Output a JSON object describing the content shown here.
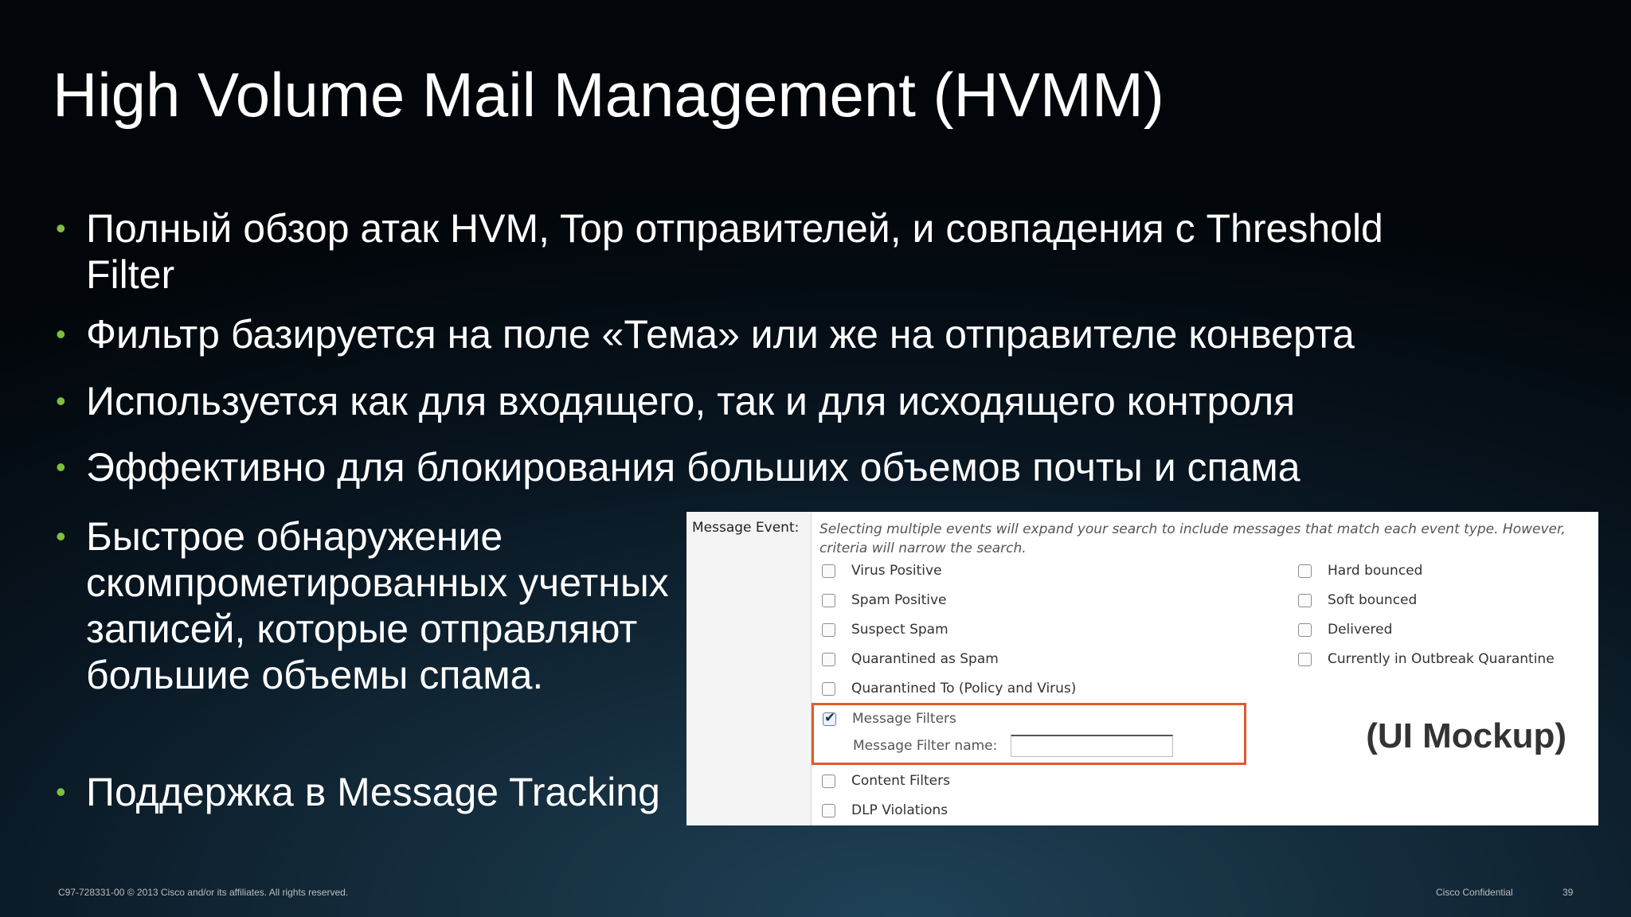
{
  "slide": {
    "title": "High Volume Mail Management (HVMM)",
    "bullets": [
      "Полный обзор атак HVM, Top отправителей, и совпадения с Threshold Filter",
      "Фильтр базируется на поле «Тема» или же на отправителе конверта",
      "Используется как для входящего, так и для исходящего контроля",
      "Эффективно для блокирования больших объемов почты и спама",
      "Быстрое обнаружение скомпрометированных учетных записей, которые отправляют большие объемы спама.",
      "Поддержка в Message Tracking"
    ],
    "bullet_marker": "•",
    "accent_color": "#7fbf3f"
  },
  "mockup": {
    "section_label": "Message Event:",
    "note": "Selecting multiple events will expand your search to include messages that match each event type. However, criteria will narrow the search.",
    "left_options": [
      {
        "label": "Virus Positive",
        "checked": false
      },
      {
        "label": "Spam Positive",
        "checked": false
      },
      {
        "label": "Suspect Spam",
        "checked": false
      },
      {
        "label": "Quarantined as Spam",
        "checked": false
      },
      {
        "label": "Quarantined To (Policy and Virus)",
        "checked": false
      },
      {
        "label": "Message Filters",
        "checked": true
      },
      {
        "label": "Content Filters",
        "checked": false
      },
      {
        "label": "DLP Violations",
        "checked": false
      }
    ],
    "right_options": [
      {
        "label": "Hard bounced",
        "checked": false
      },
      {
        "label": "Soft bounced",
        "checked": false
      },
      {
        "label": "Delivered",
        "checked": false
      },
      {
        "label": "Currently in Outbreak Quarantine",
        "checked": false
      }
    ],
    "filter_name_label": "Message Filter name:",
    "filter_name_value": "",
    "tag": "(UI Mockup)",
    "highlight_color": "#e05a2b"
  },
  "footer": {
    "copyright": "C97-728331-00 © 2013 Cisco and/or its affiliates. All rights reserved.",
    "confidential": "Cisco Confidential",
    "page": "39"
  }
}
